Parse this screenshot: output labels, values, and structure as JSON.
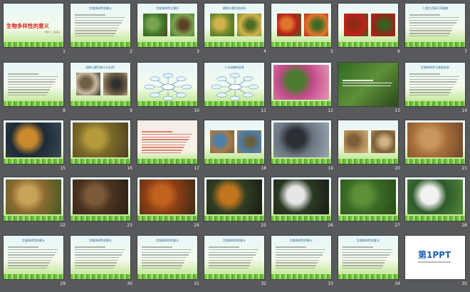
{
  "view": "slide-sorter",
  "slides": [
    {
      "n": "1",
      "title": "",
      "big": "生物多样性的意义",
      "sub": "制作人：某某某",
      "theme": "title"
    },
    {
      "n": "2",
      "title": "生物多样性的意义",
      "big": "",
      "sub": "",
      "theme": "text"
    },
    {
      "n": "3",
      "title": "生物多样性与我们",
      "big": "",
      "sub": "",
      "theme": "photo-farm"
    },
    {
      "n": "4",
      "title": "植物与我们的关系",
      "big": "",
      "sub": "",
      "theme": "photo-wheat"
    },
    {
      "n": "5",
      "title": "",
      "big": "",
      "sub": "",
      "theme": "photo-fruit"
    },
    {
      "n": "6",
      "title": "",
      "big": "",
      "sub": "",
      "theme": "photo-apples"
    },
    {
      "n": "7",
      "title": "人类生活离不开植物",
      "big": "",
      "sub": "",
      "theme": "text-right"
    },
    {
      "n": "8",
      "title": "",
      "big": "",
      "sub": "",
      "theme": "text"
    },
    {
      "n": "9",
      "title": "动物与我们有什么关系?",
      "big": "",
      "sub": "",
      "theme": "photo-cow"
    },
    {
      "n": "10",
      "title": "",
      "big": "",
      "sub": "",
      "theme": "mindmap"
    },
    {
      "n": "11",
      "title": "人与动物的关系",
      "big": "",
      "sub": "",
      "theme": "mindmap"
    },
    {
      "n": "12",
      "title": "",
      "big": "",
      "sub": "",
      "theme": "photo-flowers"
    },
    {
      "n": "13",
      "title": "",
      "big": "",
      "sub": "",
      "theme": "green-text"
    },
    {
      "n": "14",
      "title": "生物多样性与其他关系",
      "big": "",
      "sub": "",
      "theme": "text"
    },
    {
      "n": "15",
      "title": "",
      "big": "",
      "sub": "",
      "theme": "photo-fish"
    },
    {
      "n": "16",
      "title": "",
      "big": "",
      "sub": "",
      "theme": "photo-forest"
    },
    {
      "n": "17",
      "title": "",
      "big": "",
      "sub": "",
      "theme": "red-text"
    },
    {
      "n": "18",
      "title": "",
      "big": "",
      "sub": "",
      "theme": "photo-grid"
    },
    {
      "n": "19",
      "title": "",
      "big": "",
      "sub": "",
      "theme": "photo-smoke"
    },
    {
      "n": "20",
      "title": "",
      "big": "",
      "sub": "",
      "theme": "photo-desert"
    },
    {
      "n": "21",
      "title": "",
      "big": "",
      "sub": "",
      "theme": "photo-desert2"
    },
    {
      "n": "22",
      "title": "",
      "big": "",
      "sub": "",
      "theme": "photo-cheetah"
    },
    {
      "n": "23",
      "title": "",
      "big": "",
      "sub": "",
      "theme": "photo-bear"
    },
    {
      "n": "24",
      "title": "",
      "big": "",
      "sub": "",
      "theme": "photo-orangutan"
    },
    {
      "n": "25",
      "title": "",
      "big": "",
      "sub": "",
      "theme": "photo-tiger"
    },
    {
      "n": "26",
      "title": "",
      "big": "",
      "sub": "",
      "theme": "photo-panda"
    },
    {
      "n": "27",
      "title": "",
      "big": "",
      "sub": "",
      "theme": "photo-forest2"
    },
    {
      "n": "28",
      "title": "",
      "big": "",
      "sub": "",
      "theme": "photo-lily"
    },
    {
      "n": "29",
      "title": "生物多样性的意义",
      "big": "",
      "sub": "",
      "theme": "text"
    },
    {
      "n": "30",
      "title": "生物多样性的意义",
      "big": "",
      "sub": "",
      "theme": "text"
    },
    {
      "n": "31",
      "title": "生物多样性的意义",
      "big": "",
      "sub": "",
      "theme": "text"
    },
    {
      "n": "32",
      "title": "生物多样性的意义",
      "big": "",
      "sub": "",
      "theme": "text"
    },
    {
      "n": "33",
      "title": "生物多样性的意义",
      "big": "",
      "sub": "",
      "theme": "text"
    },
    {
      "n": "34",
      "title": "生物多样性的意义",
      "big": "",
      "sub": "",
      "theme": "text"
    },
    {
      "n": "35",
      "title": "",
      "big": "第1PPT",
      "sub": "",
      "theme": "logo"
    }
  ],
  "colors": {
    "background": "#58595b",
    "slide_text": "#d7261c",
    "number": "#f0f0f0"
  }
}
